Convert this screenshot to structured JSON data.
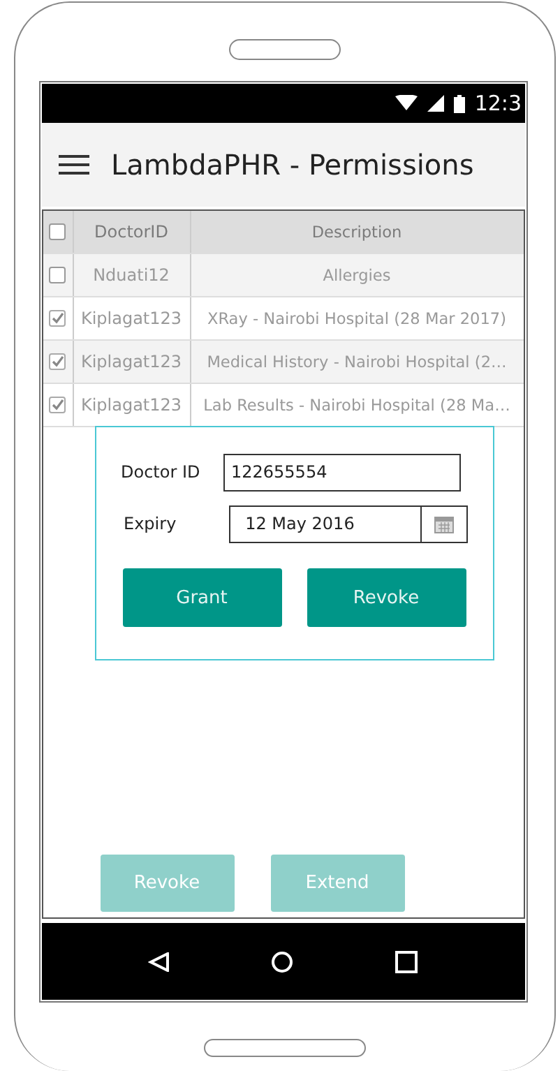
{
  "status_bar": {
    "time": "12:3"
  },
  "app_bar": {
    "title": "LambdaPHR - Permissions"
  },
  "table": {
    "disabled": true,
    "header_checkbox": {
      "checked": false
    },
    "columns": [
      "DoctorID",
      "Description"
    ],
    "rows": [
      {
        "checked": false,
        "doctor_id": "Nduati12",
        "description": "Allergies"
      },
      {
        "checked": true,
        "doctor_id": "Kiplagat123",
        "description": "XRay - Nairobi Hospital  (28 Mar 2017)"
      },
      {
        "checked": true,
        "doctor_id": "Kiplagat123",
        "description": "Medical History - Nairobi Hospital (2…"
      },
      {
        "checked": true,
        "doctor_id": "Kiplagat123",
        "description": "Lab Results - Nairobi Hospital (28 Ma…"
      }
    ]
  },
  "dialog": {
    "doctor_id": {
      "label": "Doctor ID",
      "value": "122655554"
    },
    "expiry": {
      "label": "Expiry",
      "value": "12 May 2016"
    },
    "buttons": [
      {
        "label": "Grant",
        "disabled": false
      },
      {
        "label": "Revoke",
        "disabled": false
      }
    ]
  },
  "bottom_buttons": [
    {
      "label": "Revoke",
      "disabled": true
    },
    {
      "label": "Extend",
      "disabled": true
    }
  ]
}
